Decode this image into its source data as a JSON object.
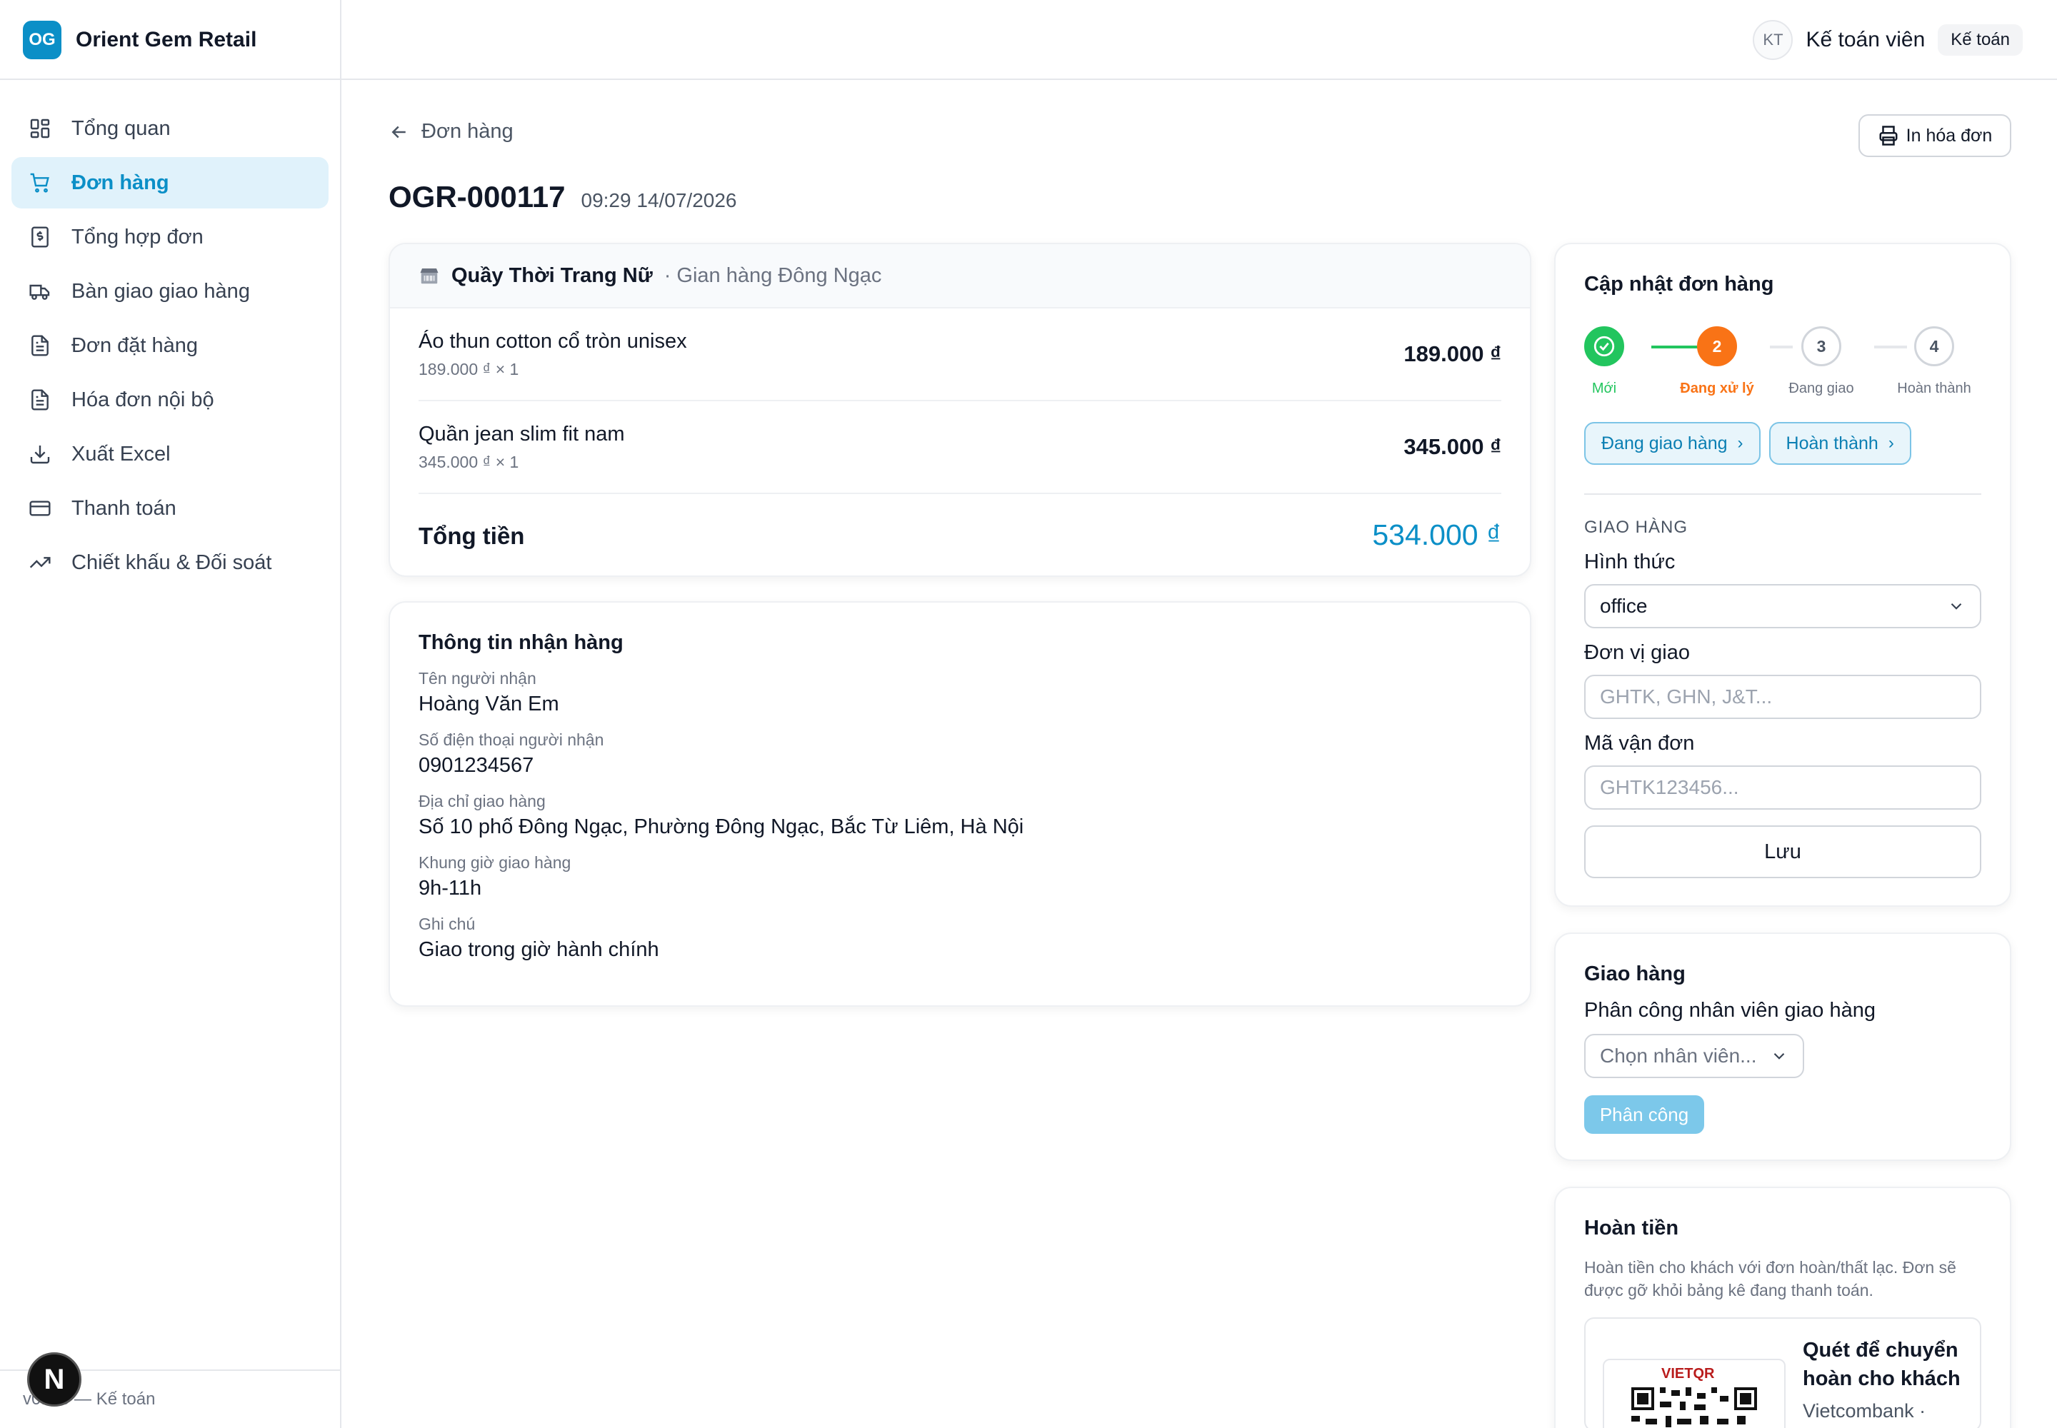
{
  "app": {
    "logo_initials": "OG",
    "name": "Orient Gem Retail",
    "accent": "#0b8fc7"
  },
  "user": {
    "initials": "KT",
    "name": "Kế toán viên",
    "role": "Kế toán"
  },
  "sidebar": {
    "items": [
      {
        "label": "Tổng quan",
        "icon": "dashboard-icon",
        "active": false
      },
      {
        "label": "Đơn hàng",
        "icon": "cart-icon",
        "active": true
      },
      {
        "label": "Tổng hợp đơn",
        "icon": "dollar-doc-icon",
        "active": false
      },
      {
        "label": "Bàn giao giao hàng",
        "icon": "truck-icon",
        "active": false
      },
      {
        "label": "Đơn đặt hàng",
        "icon": "document-icon",
        "active": false
      },
      {
        "label": "Hóa đơn nội bộ",
        "icon": "document-icon",
        "active": false
      },
      {
        "label": "Xuất Excel",
        "icon": "download-icon",
        "active": false
      },
      {
        "label": "Thanh toán",
        "icon": "credit-card-icon",
        "active": false
      },
      {
        "label": "Chiết khấu & Đối soát",
        "icon": "trending-up-icon",
        "active": false
      }
    ],
    "footer": "v0.1.0 — Kế toán",
    "next_badge": "N"
  },
  "header": {
    "back_label": "Đơn hàng",
    "print_label": "In hóa đơn",
    "order_code": "OGR-000117",
    "order_time": "09:29 14/07/2026"
  },
  "order": {
    "store_name": "Quầy Thời Trang Nữ",
    "store_sub": "· Gian hàng Đông Ngạc",
    "items": [
      {
        "name": "Áo thun cotton cổ tròn unisex",
        "sub": "189.000 ₫ × 1",
        "price": "189.000 ₫"
      },
      {
        "name": "Quần jean slim fit nam",
        "sub": "345.000 ₫ × 1",
        "price": "345.000 ₫"
      }
    ],
    "total_label": "Tổng tiền",
    "total_value": "534.000 ₫"
  },
  "receiver": {
    "title": "Thông tin nhận hàng",
    "fields": [
      {
        "label": "Tên người nhận",
        "value": "Hoàng Văn Em"
      },
      {
        "label": "Số điện thoại người nhận",
        "value": "0901234567"
      },
      {
        "label": "Địa chỉ giao hàng",
        "value": "Số 10 phố Đông Ngạc, Phường Đông Ngạc, Bắc Từ Liêm, Hà Nội"
      },
      {
        "label": "Khung giờ giao hàng",
        "value": "9h-11h"
      },
      {
        "label": "Ghi chú",
        "value": "Giao trong giờ hành chính"
      }
    ]
  },
  "update": {
    "title": "Cập nhật đơn hàng",
    "steps": [
      {
        "number": "1",
        "label": "Mới",
        "state": "done"
      },
      {
        "number": "2",
        "label": "Đang xử lý",
        "state": "current"
      },
      {
        "number": "3",
        "label": "Đang giao",
        "state": "pending"
      },
      {
        "number": "4",
        "label": "Hoàn thành",
        "state": "pending"
      }
    ],
    "actions": [
      "Đang giao hàng",
      "Hoàn thành"
    ],
    "section_caps": "GIAO HÀNG",
    "method_label": "Hình thức",
    "method_value": "office",
    "carrier_label": "Đơn vị giao",
    "carrier_placeholder": "GHTK, GHN, J&T...",
    "tracking_label": "Mã vận đơn",
    "tracking_placeholder": "GHTK123456...",
    "save_label": "Lưu"
  },
  "delivery": {
    "title": "Giao hàng",
    "assign_label": "Phân công nhân viên giao hàng",
    "select_placeholder": "Chọn nhân viên...",
    "assign_button": "Phân công"
  },
  "refund": {
    "title": "Hoàn tiền",
    "description": "Hoàn tiền cho khách với đơn hoàn/thất lạc. Đơn sẽ được gỡ khỏi bảng kê đang thanh toán.",
    "qr_logo": "VIETQR",
    "qr_title": "Quét để chuyển hoàn cho khách",
    "qr_bank": "Vietcombank ·"
  }
}
